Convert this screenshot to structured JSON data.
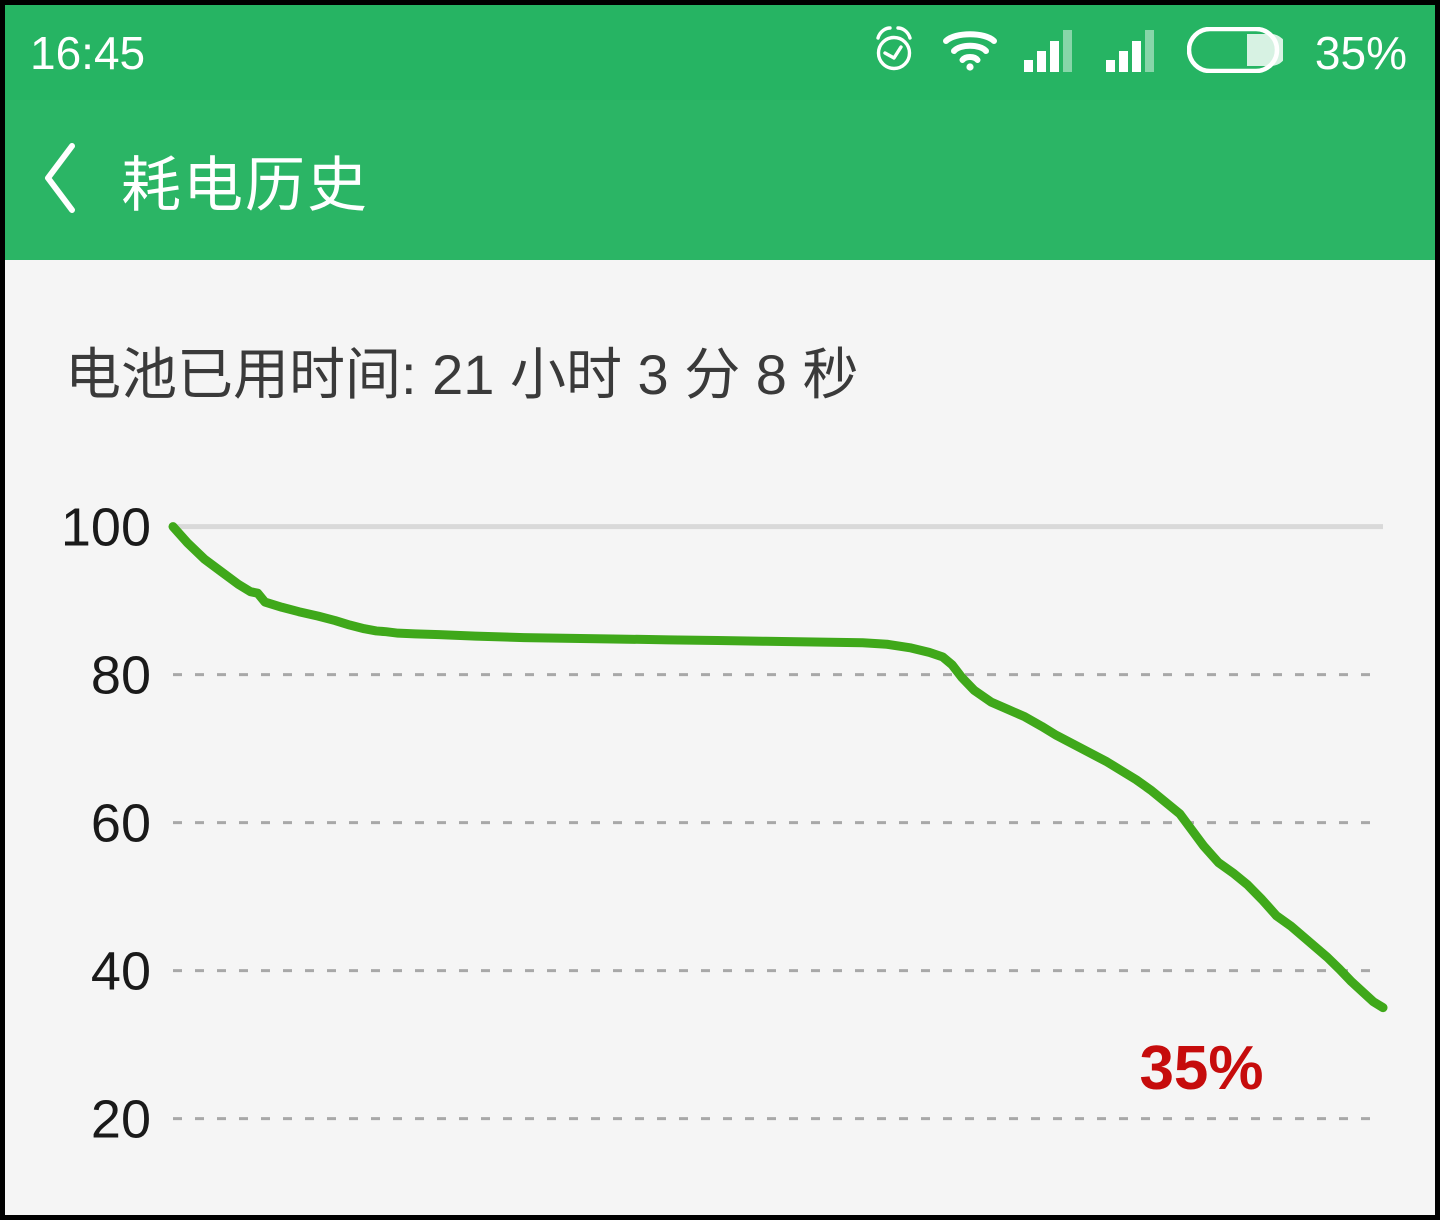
{
  "statusbar": {
    "time": "16:45",
    "battery_percent": "35%",
    "icons": [
      "alarm-clock-icon",
      "wifi-icon",
      "signal-sim1-icon",
      "signal-sim2-icon",
      "battery-icon"
    ]
  },
  "appbar": {
    "title": "耗电历史",
    "back_icon": "chevron-left-icon",
    "background_color": "#2bb565"
  },
  "main": {
    "usage_time_text": "电池已用时间: 21 小时 3 分 8 秒"
  },
  "chart_data": {
    "type": "line",
    "title": "",
    "xlabel": "",
    "ylabel": "",
    "ylim": [
      14,
      104
    ],
    "yticks": [
      100,
      80,
      60,
      40,
      20
    ],
    "ytick_labels": [
      "100",
      "80",
      "60",
      "40",
      "20"
    ],
    "grid": true,
    "grid_solid_at": 100,
    "series": [
      {
        "name": "battery-level",
        "color": "#3fa81a",
        "x": [
          0.0,
          1.2,
          2.6,
          4.0,
          5.4,
          6.4,
          7.0,
          7.6,
          9.0,
          10.4,
          12.0,
          13.4,
          14.6,
          15.8,
          16.8,
          17.6,
          18.6,
          20.0,
          22.0,
          25.0,
          29.0,
          33.0,
          37.0,
          41.0,
          45.0,
          49.0,
          53.0,
          57.0,
          59.0,
          61.0,
          62.5,
          63.6,
          64.4,
          65.2,
          66.2,
          67.6,
          69.0,
          70.4,
          71.8,
          73.0,
          74.4,
          75.8,
          77.2,
          78.4,
          79.6,
          80.8,
          82.0,
          83.2,
          84.2,
          85.2,
          86.4,
          87.6,
          88.8,
          90.0,
          91.2,
          92.4,
          93.4,
          94.4,
          95.4,
          96.4,
          97.4,
          98.4,
          99.2,
          100.0
        ],
        "y": [
          100.0,
          97.8,
          95.6,
          93.9,
          92.2,
          91.2,
          91.0,
          89.8,
          89.1,
          88.5,
          87.9,
          87.3,
          86.7,
          86.2,
          85.9,
          85.8,
          85.6,
          85.5,
          85.4,
          85.2,
          85.0,
          84.9,
          84.8,
          84.7,
          84.6,
          84.5,
          84.4,
          84.3,
          84.1,
          83.6,
          83.0,
          82.4,
          81.3,
          79.6,
          77.9,
          76.3,
          75.3,
          74.3,
          73.0,
          71.8,
          70.6,
          69.4,
          68.2,
          67.0,
          65.8,
          64.4,
          62.8,
          61.2,
          59.0,
          56.8,
          54.6,
          53.2,
          51.6,
          49.6,
          47.4,
          46.0,
          44.6,
          43.2,
          41.8,
          40.2,
          38.5,
          37.0,
          35.8,
          35.0
        ]
      }
    ],
    "annotations": [
      {
        "name": "current-battery-label",
        "text": "35%",
        "color": "#c60c0c",
        "x": 85.0,
        "y": 24.0
      }
    ]
  }
}
